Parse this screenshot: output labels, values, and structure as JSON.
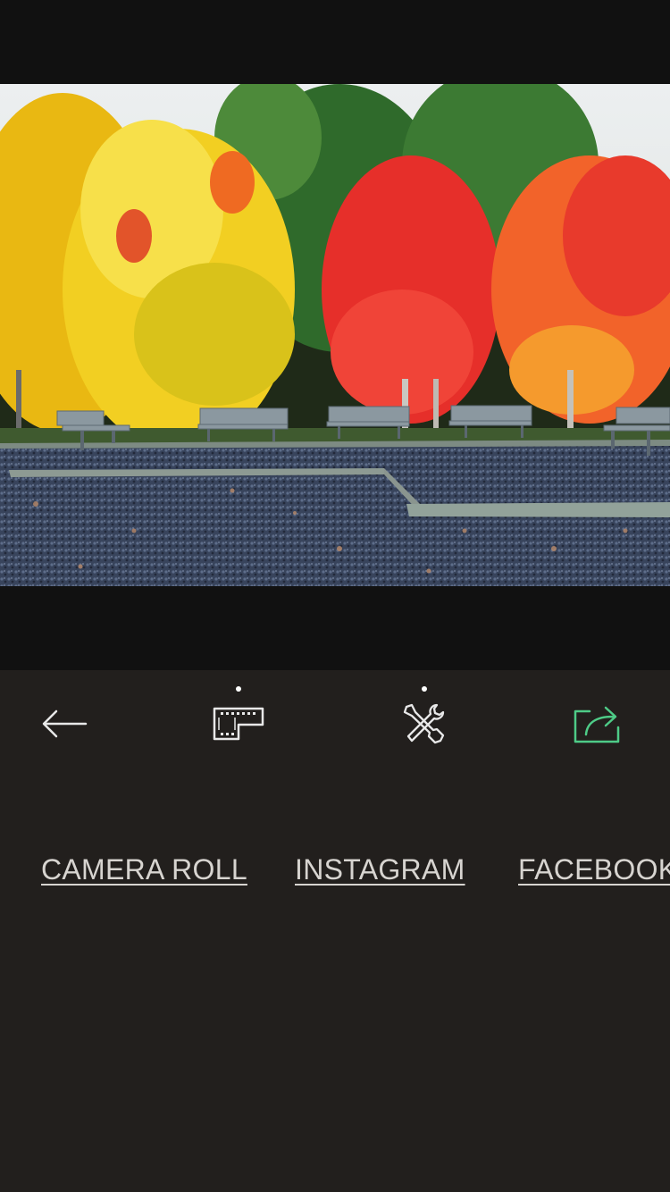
{
  "toolbar": {
    "back": {
      "icon": "back-arrow-icon"
    },
    "film": {
      "icon": "film-frame-icon",
      "has_indicator": true
    },
    "tools": {
      "icon": "tools-icon",
      "has_indicator": true
    },
    "share": {
      "icon": "share-icon",
      "color": "#4ecb87"
    }
  },
  "share_targets": {
    "camera_roll": "CAMERA ROLL",
    "instagram": "INSTAGRAM",
    "facebook": "FACEBOOK"
  },
  "colors": {
    "top_background": "#111111",
    "panel_background": "#221f1d",
    "icon": "#e8e8e8",
    "accent": "#4ecb87",
    "link_text": "#d7d4d0"
  }
}
